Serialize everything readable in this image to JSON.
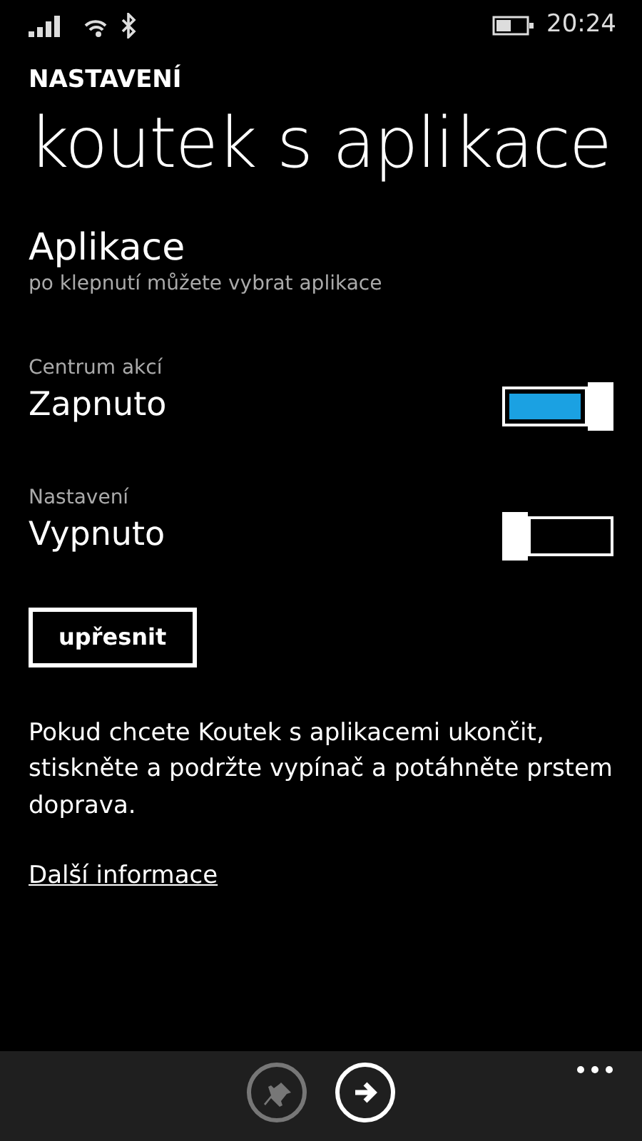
{
  "status_bar": {
    "time": "20:24"
  },
  "header": {
    "app": "NASTAVENÍ",
    "title": "koutek s aplikace"
  },
  "apps": {
    "title": "Aplikace",
    "subtitle": "po klepnutí můžete vybrat aplikace"
  },
  "toggles": [
    {
      "label": "Centrum akcí",
      "state": "Zapnuto",
      "on": true
    },
    {
      "label": "Nastavení",
      "state": "Vypnuto",
      "on": false
    }
  ],
  "advanced_button": "upřesnit",
  "info": "Pokud chcete Koutek s aplikacemi ukončit, stiskněte a podržte vypínač a potáhněte prstem doprava.",
  "more_link": "Další informace",
  "app_bar": {
    "buttons": [
      {
        "kind": "pin",
        "disabled": true
      },
      {
        "kind": "next",
        "disabled": false
      }
    ]
  }
}
